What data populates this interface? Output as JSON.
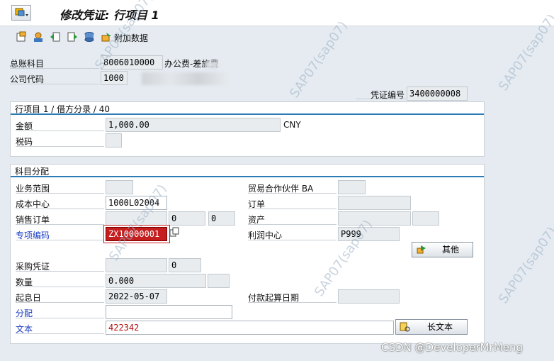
{
  "window": {
    "title": "修改凭证: 行项目 1"
  },
  "toolbar": {
    "additional_data_label": "附加数据"
  },
  "header": {
    "gl_account_label": "总账科目",
    "gl_account_value": "8006010000",
    "gl_account_desc": "办公费-差旅费",
    "company_code_label": "公司代码",
    "company_code_value": "1000",
    "doc_no_label": "凭证编号",
    "doc_no_value": "3400000008"
  },
  "item_section": {
    "title": "行项目 1 / 借方分录 / 40",
    "amount_label": "金额",
    "amount_value": "1,000.00",
    "currency": "CNY",
    "tax_code_label": "税码",
    "tax_code_value": ""
  },
  "assignment_section": {
    "title": "科目分配",
    "business_area_label": "业务范围",
    "business_area_value": "",
    "trading_partner_label": "贸易合作伙伴 BA",
    "trading_partner_value": "",
    "cost_center_label": "成本中心",
    "cost_center_value": "1000L02004",
    "order_label": "订单",
    "order_value": "",
    "sales_order_label": "销售订单",
    "sales_order_value": "",
    "sales_order_item": "0",
    "sales_order_sched": "0",
    "asset_label": "资产",
    "asset_value": "",
    "asset_sub": "",
    "special_code_label": "专项编码",
    "special_code_value": "ZX10000001",
    "profit_center_label": "利润中心",
    "profit_center_value": "P999",
    "other_button": "其他",
    "po_label": "采购凭证",
    "po_value": "",
    "po_item": "0",
    "quantity_label": "数量",
    "quantity_value": "0.000",
    "quantity_unit": "",
    "value_date_label": "起息日",
    "value_date_value": "2022-05-07",
    "baseline_date_label": "付款起算日期",
    "baseline_date_value": "",
    "assignment_label": "分配",
    "assignment_value": "",
    "text_label": "文本",
    "text_value": "422342",
    "long_text_button": "长文本"
  },
  "watermark": {
    "csdn": "CSDN @DeveloperMrMeng",
    "user": "SAP07(sap07)"
  },
  "colors": {
    "accent": "#2d7bb5",
    "link": "#1a3dc2",
    "focus": "#b01010"
  }
}
